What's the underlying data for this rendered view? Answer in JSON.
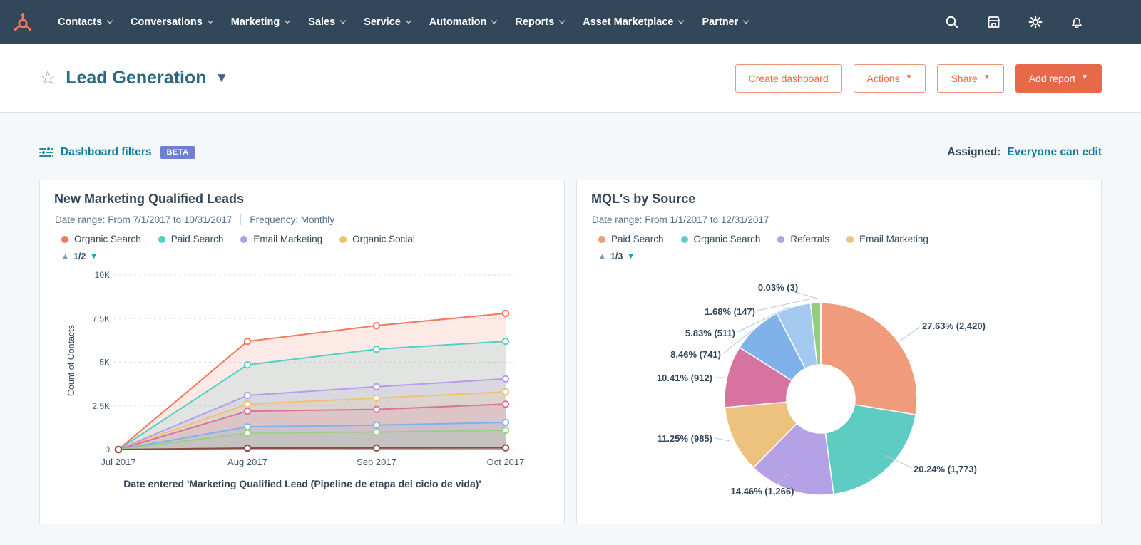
{
  "navbar": {
    "items": [
      "Contacts",
      "Conversations",
      "Marketing",
      "Sales",
      "Service",
      "Automation",
      "Reports",
      "Asset Marketplace",
      "Partner"
    ]
  },
  "header": {
    "title": "Lead Generation",
    "create_dashboard": "Create dashboard",
    "actions": "Actions",
    "share": "Share",
    "add_report": "Add report"
  },
  "filters": {
    "label": "Dashboard filters",
    "beta": "BETA",
    "assigned": "Assigned:",
    "assigned_value": "Everyone can edit"
  },
  "colors": {
    "accent_orange": "#e8684a",
    "nav_bg": "#33475b",
    "link_teal": "#0e7a9e",
    "beta_badge": "#6f7fd4"
  },
  "chart_data": [
    {
      "type": "area",
      "title": "New Marketing Qualified Leads",
      "date_range": "Date range: From 7/1/2017 to 10/31/2017",
      "frequency": "Frequency: Monthly",
      "pager": "1/2",
      "legend": [
        {
          "label": "Organic Search",
          "color": "#f2795c"
        },
        {
          "label": "Paid Search",
          "color": "#52cfc5"
        },
        {
          "label": "Email Marketing",
          "color": "#b49ce8"
        },
        {
          "label": "Organic Social",
          "color": "#f3c06f"
        }
      ],
      "x": [
        "Jul 2017",
        "Aug 2017",
        "Sep 2017",
        "Oct 2017"
      ],
      "ylabel": "Count of Contacts",
      "ylim": [
        0,
        10000
      ],
      "yticks": [
        0,
        2500,
        5000,
        7500,
        10000
      ],
      "ytick_labels": [
        "0",
        "2.5K",
        "5K",
        "7.5K",
        "10K"
      ],
      "grid": true,
      "series": [
        {
          "name": "Organic Search",
          "color": "#f2795c",
          "values": [
            0,
            6200,
            7100,
            7800
          ]
        },
        {
          "name": "Paid Search",
          "color": "#52cfc5",
          "values": [
            0,
            4850,
            5750,
            6200
          ]
        },
        {
          "name": "Email Marketing",
          "color": "#b49ce8",
          "values": [
            0,
            3100,
            3600,
            4050
          ]
        },
        {
          "name": "Organic Social",
          "color": "#f3c06f",
          "values": [
            0,
            2600,
            2950,
            3300
          ]
        },
        {
          "name": "",
          "color": "#d9729f",
          "values": [
            0,
            2200,
            2300,
            2600
          ]
        },
        {
          "name": "",
          "color": "#7fb2e8",
          "values": [
            0,
            1300,
            1400,
            1550
          ]
        },
        {
          "name": "",
          "color": "#9ccf85",
          "values": [
            0,
            950,
            1000,
            1100
          ]
        },
        {
          "name": "",
          "color": "#8e4a42",
          "values": [
            0,
            80,
            90,
            100
          ]
        }
      ],
      "caption": "Date entered 'Marketing Qualified Lead (Pipeline de etapa del ciclo de vida)'"
    },
    {
      "type": "pie",
      "title": "MQL's by Source",
      "date_range": "Date range: From 1/1/2017 to 12/31/2017",
      "pager": "1/3",
      "legend": [
        {
          "label": "Paid Search",
          "color": "#f09b7c"
        },
        {
          "label": "Organic Search",
          "color": "#5fccc4"
        },
        {
          "label": "Referrals",
          "color": "#b5a1e6"
        },
        {
          "label": "Email Marketing",
          "color": "#ecc27e"
        }
      ],
      "slices": [
        {
          "name": "Paid Search",
          "label": "27.63% (2,420)",
          "pct": 27.63,
          "count": 2420,
          "color": "#f09b7c"
        },
        {
          "name": "Organic Search",
          "label": "20.24% (1,773)",
          "pct": 20.24,
          "count": 1773,
          "color": "#5fccc4"
        },
        {
          "name": "Referrals",
          "label": "14.46% (1,266)",
          "pct": 14.46,
          "count": 1266,
          "color": "#b5a1e6"
        },
        {
          "name": "Email Marketing",
          "label": "11.25% (985)",
          "pct": 11.25,
          "count": 985,
          "color": "#ecc27e"
        },
        {
          "label": "10.41% (912)",
          "pct": 10.41,
          "count": 912,
          "color": "#d6739f"
        },
        {
          "label": "8.46% (741)",
          "pct": 8.46,
          "count": 741,
          "color": "#7fb2e8"
        },
        {
          "label": "5.83% (511)",
          "pct": 5.83,
          "count": 511,
          "color": "#a3c9f1"
        },
        {
          "label": "1.68% (147)",
          "pct": 1.68,
          "count": 147,
          "color": "#93cd80"
        },
        {
          "label": "0.03% (3)",
          "pct": 0.03,
          "count": 3,
          "color": "#7e3b36"
        }
      ]
    }
  ]
}
